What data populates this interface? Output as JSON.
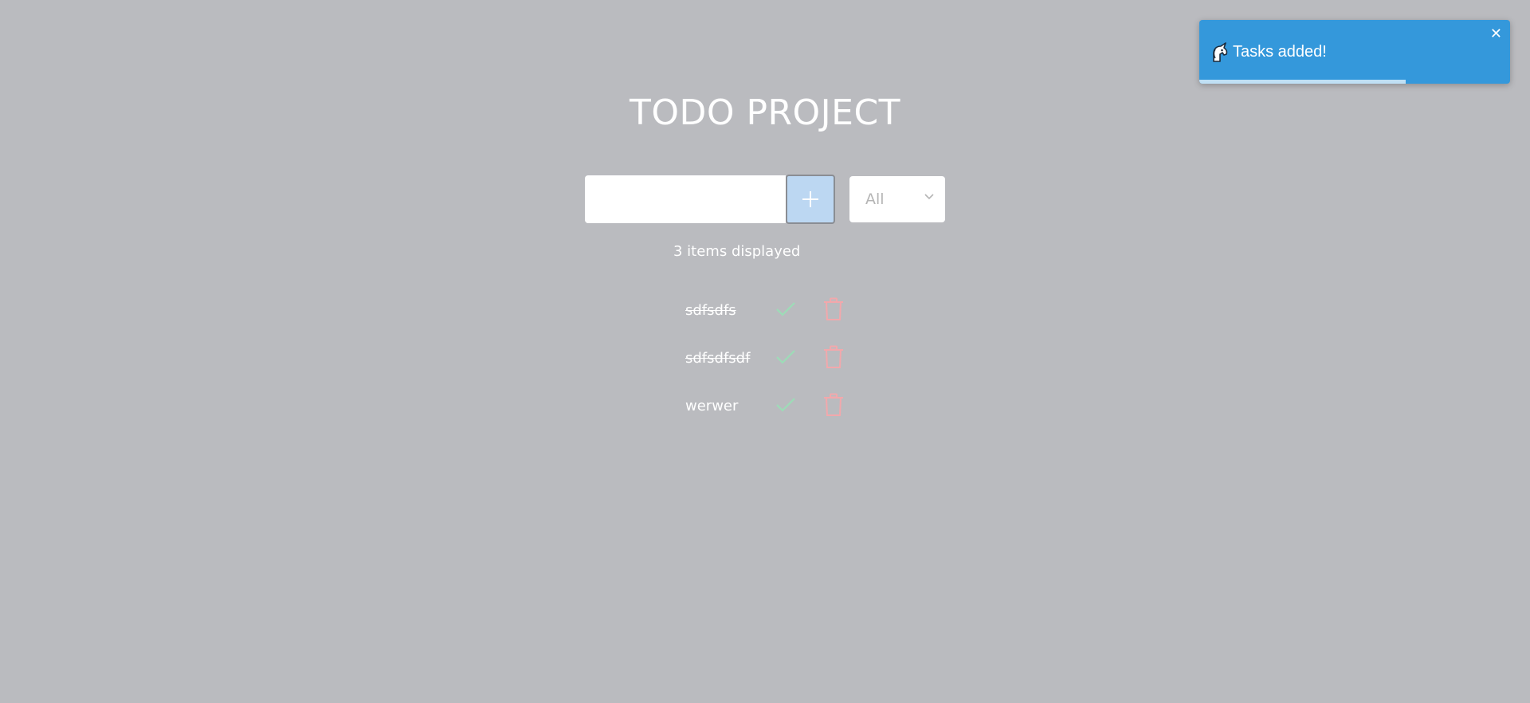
{
  "header": {
    "title": "TODO PROJECT"
  },
  "form": {
    "input_value": "",
    "add_button_icon": "plus-icon",
    "filter": {
      "selected": "All",
      "icon": "chevron-down-icon"
    }
  },
  "status": {
    "count_text": "3 items displayed"
  },
  "todos": [
    {
      "text": "sdfsdfs",
      "completed": true
    },
    {
      "text": "sdfsdfsdf",
      "completed": true
    },
    {
      "text": "werwer",
      "completed": false
    }
  ],
  "icons": {
    "complete": "check-icon",
    "delete": "trash-icon",
    "toast": "unicorn-icon",
    "close": "close-icon"
  },
  "toast": {
    "message": "Tasks added!",
    "close_label": "✕",
    "progress": 0.665
  },
  "colors": {
    "background": "#babbbf",
    "accent_toast": "#3498db",
    "add_button": "#bcd7f2",
    "check": "#9ddcb7",
    "trash": "#f2a8ac"
  }
}
